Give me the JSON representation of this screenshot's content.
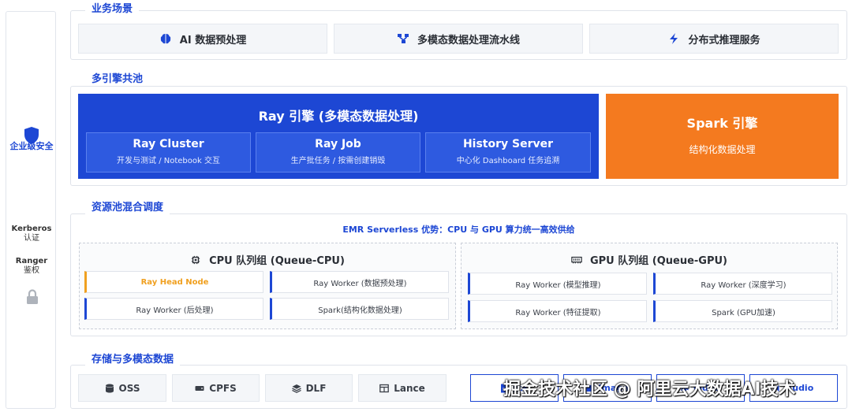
{
  "sidebar": {
    "security_label": "企业级安全",
    "kerberos_title": "Kerberos",
    "kerberos_sub": "认证",
    "ranger_title": "Ranger",
    "ranger_sub": "鉴权"
  },
  "business": {
    "title": "业务场景",
    "cards": [
      {
        "label": "AI 数据预处理",
        "icon": "brain-icon"
      },
      {
        "label": "多模态数据处理流水线",
        "icon": "network-icon"
      },
      {
        "label": "分布式推理服务",
        "icon": "bolt-icon"
      }
    ]
  },
  "engines": {
    "title": "多引擎共池",
    "ray": {
      "title": "Ray 引擎 (多模态数据处理)",
      "subs": [
        {
          "title": "Ray Cluster",
          "desc": "开发与测试 / Notebook 交互"
        },
        {
          "title": "Ray Job",
          "desc": "生产批任务 / 按需创建销毁"
        },
        {
          "title": "History Server",
          "desc": "中心化 Dashboard 任务追溯"
        }
      ]
    },
    "spark": {
      "title": "Spark 引擎",
      "desc": "结构化数据处理"
    }
  },
  "resource": {
    "title": "资源池混合调度",
    "advantage": "EMR Serverless 优势：CPU 与 GPU 算力统一高效供给",
    "cpu": {
      "title": "CPU 队列组 (Queue-CPU)",
      "nodes": [
        "Ray Head Node",
        "Ray Worker (数据预处理)",
        "Ray Worker (后处理)",
        "Spark(结构化数据处理)"
      ]
    },
    "gpu": {
      "title": "GPU 队列组 (Queue-GPU)",
      "nodes": [
        "Ray Worker (模型推理)",
        "Ray Worker (深度学习)",
        "Ray Worker (特征提取)",
        "Spark (GPU加速)"
      ]
    }
  },
  "storage": {
    "title": "存储与多模态数据",
    "items": [
      {
        "label": "OSS",
        "icon": "database-icon"
      },
      {
        "label": "CPFS",
        "icon": "drive-icon"
      },
      {
        "label": "DLF",
        "icon": "layers-icon"
      },
      {
        "label": "Lance",
        "icon": "table-icon"
      }
    ],
    "multimodal": [
      {
        "label": "文本",
        "icon": "file-icon"
      },
      {
        "label": "Image",
        "icon": "image-icon"
      },
      {
        "label": "Video",
        "icon": "video-icon"
      },
      {
        "label": "Audio",
        "icon": "audio-icon"
      }
    ]
  },
  "watermark": "掘金技术社区 @ 阿里云大数据AI技术",
  "colors": {
    "primary": "#1d47d4",
    "spark": "#f47a1f",
    "head_node": "#f0a020"
  }
}
